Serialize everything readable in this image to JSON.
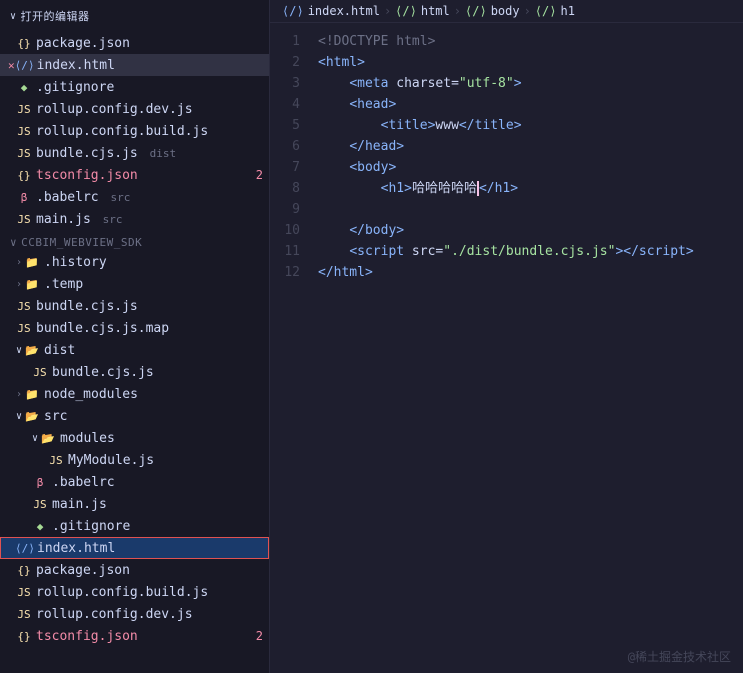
{
  "sidebar": {
    "header": "打开的编辑器",
    "section2": "CCBIM_WEBVIEW_SDK",
    "openFiles": [
      {
        "icon": "json",
        "name": "package.json",
        "badge": ""
      },
      {
        "icon": "html",
        "name": "index.html",
        "badge": "",
        "active": true,
        "close": true
      }
    ],
    "tree": [
      {
        "indent": 1,
        "type": "file",
        "icon": "git",
        "name": ".gitignore"
      },
      {
        "indent": 1,
        "type": "file",
        "icon": "js",
        "name": "rollup.config.dev.js"
      },
      {
        "indent": 1,
        "type": "file",
        "icon": "js",
        "name": "rollup.config.build.js"
      },
      {
        "indent": 1,
        "type": "file",
        "icon": "js",
        "name": "bundle.cjs.js",
        "tag": "dist"
      },
      {
        "indent": 1,
        "type": "file",
        "icon": "json",
        "name": "tsconfig.json",
        "badge": "2"
      },
      {
        "indent": 1,
        "type": "file",
        "icon": "babel",
        "name": ".babelrc",
        "tag": "src"
      },
      {
        "indent": 1,
        "type": "file",
        "icon": "js",
        "name": "main.js",
        "tag": "src"
      },
      {
        "indent": 0,
        "type": "section",
        "name": "CCBIM_WEBVIEW_SDK"
      },
      {
        "indent": 1,
        "type": "folder-closed",
        "name": ".history"
      },
      {
        "indent": 1,
        "type": "folder-closed",
        "name": ".temp"
      },
      {
        "indent": 1,
        "type": "file",
        "icon": "js",
        "name": "bundle.cjs.js"
      },
      {
        "indent": 1,
        "type": "file",
        "icon": "js",
        "name": "bundle.cjs.js.map"
      },
      {
        "indent": 1,
        "type": "folder-open",
        "name": "dist"
      },
      {
        "indent": 2,
        "type": "file",
        "icon": "js",
        "name": "bundle.cjs.js"
      },
      {
        "indent": 1,
        "type": "folder-closed",
        "name": "node_modules"
      },
      {
        "indent": 1,
        "type": "folder-open",
        "name": "src"
      },
      {
        "indent": 2,
        "type": "folder-open",
        "name": "modules"
      },
      {
        "indent": 3,
        "type": "file",
        "icon": "js",
        "name": "MyModule.js"
      },
      {
        "indent": 2,
        "type": "file",
        "icon": "babel",
        "name": ".babelrc"
      },
      {
        "indent": 2,
        "type": "file",
        "icon": "js",
        "name": "main.js"
      },
      {
        "indent": 2,
        "type": "file",
        "icon": "git",
        "name": ".gitignore"
      },
      {
        "indent": 1,
        "type": "file",
        "icon": "html",
        "name": "index.html",
        "highlighted": true
      },
      {
        "indent": 1,
        "type": "file",
        "icon": "json",
        "name": "package.json"
      },
      {
        "indent": 1,
        "type": "file",
        "icon": "js",
        "name": "rollup.config.build.js"
      },
      {
        "indent": 1,
        "type": "file",
        "icon": "js",
        "name": "rollup.config.dev.js"
      },
      {
        "indent": 1,
        "type": "file",
        "icon": "json",
        "name": "tsconfig.json",
        "badge": "2"
      }
    ]
  },
  "breadcrumb": {
    "file": "index.html",
    "path": [
      "html",
      "body",
      "h1"
    ]
  },
  "editor": {
    "lines": [
      {
        "num": 1,
        "tokens": [
          {
            "t": "<!DOCTYPE html>",
            "c": "s-doctype"
          }
        ]
      },
      {
        "num": 2,
        "tokens": [
          {
            "t": "<",
            "c": "s-tag"
          },
          {
            "t": "html",
            "c": "s-tag"
          },
          {
            "t": ">",
            "c": "s-tag"
          }
        ]
      },
      {
        "num": 3,
        "tokens": [
          {
            "t": "    ",
            "c": ""
          },
          {
            "t": "<",
            "c": "s-tag"
          },
          {
            "t": "meta",
            "c": "s-tag"
          },
          {
            "t": " charset=",
            "c": "s-text"
          },
          {
            "t": "\"utf-8\"",
            "c": "s-val"
          },
          {
            "t": ">",
            "c": "s-tag"
          }
        ]
      },
      {
        "num": 4,
        "tokens": [
          {
            "t": "    ",
            "c": ""
          },
          {
            "t": "<",
            "c": "s-tag"
          },
          {
            "t": "head",
            "c": "s-tag"
          },
          {
            "t": ">",
            "c": "s-tag"
          }
        ]
      },
      {
        "num": 5,
        "tokens": [
          {
            "t": "        ",
            "c": ""
          },
          {
            "t": "<",
            "c": "s-tag"
          },
          {
            "t": "title",
            "c": "s-tag"
          },
          {
            "t": ">",
            "c": "s-tag"
          },
          {
            "t": "www",
            "c": "s-text"
          },
          {
            "t": "</",
            "c": "s-tag"
          },
          {
            "t": "title",
            "c": "s-tag"
          },
          {
            "t": ">",
            "c": "s-tag"
          }
        ]
      },
      {
        "num": 6,
        "tokens": [
          {
            "t": "    ",
            "c": ""
          },
          {
            "t": "</",
            "c": "s-tag"
          },
          {
            "t": "head",
            "c": "s-tag"
          },
          {
            "t": ">",
            "c": "s-tag"
          }
        ]
      },
      {
        "num": 7,
        "tokens": [
          {
            "t": "    ",
            "c": ""
          },
          {
            "t": "<",
            "c": "s-tag"
          },
          {
            "t": "body",
            "c": "s-tag"
          },
          {
            "t": ">",
            "c": "s-tag"
          }
        ]
      },
      {
        "num": 8,
        "tokens": [
          {
            "t": "        ",
            "c": ""
          },
          {
            "t": "<",
            "c": "s-tag"
          },
          {
            "t": "h1",
            "c": "s-tag"
          },
          {
            "t": ">",
            "c": "s-tag"
          },
          {
            "t": "哈哈哈哈哈",
            "c": "s-chinese"
          },
          {
            "t": "CURSOR",
            "c": ""
          },
          {
            "t": "</",
            "c": "s-tag"
          },
          {
            "t": "h1",
            "c": "s-tag"
          },
          {
            "t": ">",
            "c": "s-tag"
          }
        ]
      },
      {
        "num": 9,
        "tokens": []
      },
      {
        "num": 10,
        "tokens": [
          {
            "t": "    ",
            "c": ""
          },
          {
            "t": "</",
            "c": "s-tag"
          },
          {
            "t": "body",
            "c": "s-tag"
          },
          {
            "t": ">",
            "c": "s-tag"
          }
        ]
      },
      {
        "num": 11,
        "tokens": [
          {
            "t": "    ",
            "c": ""
          },
          {
            "t": "<",
            "c": "s-tag"
          },
          {
            "t": "script",
            "c": "s-tag"
          },
          {
            "t": " src=",
            "c": "s-text"
          },
          {
            "t": "\"./dist/bundle.cjs.js\"",
            "c": "s-val"
          },
          {
            "t": "></",
            "c": "s-tag"
          },
          {
            "t": "script",
            "c": "s-tag"
          },
          {
            "t": ">",
            "c": "s-tag"
          }
        ]
      },
      {
        "num": 12,
        "tokens": [
          {
            "t": "</",
            "c": "s-tag"
          },
          {
            "t": "html",
            "c": "s-tag"
          },
          {
            "t": ">",
            "c": "s-tag"
          }
        ]
      }
    ]
  },
  "watermark": "@稀土掘金技术社区"
}
